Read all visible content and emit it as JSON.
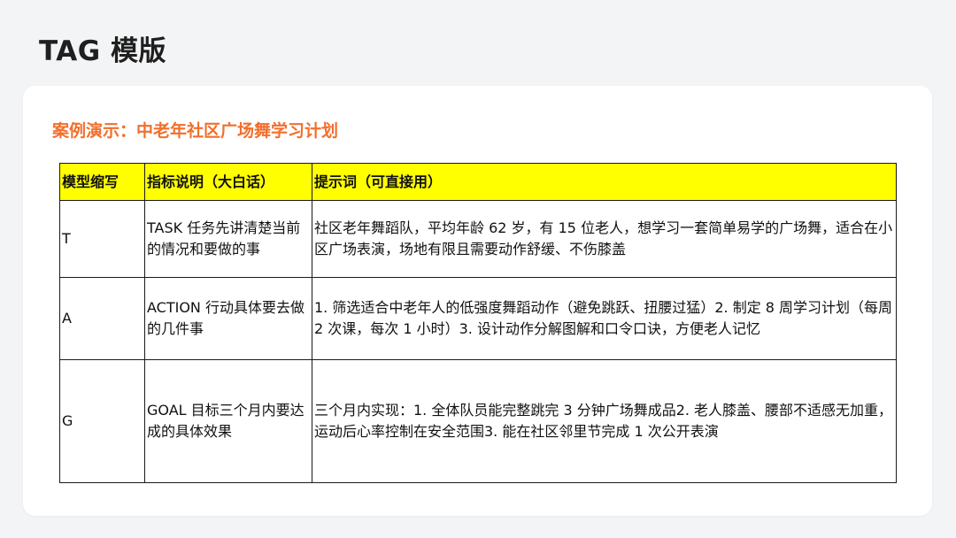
{
  "page": {
    "title": "TAG 模版"
  },
  "card": {
    "case_title": "案例演示：中老年社区广场舞学习计划"
  },
  "table": {
    "headers": [
      "模型缩写",
      "指标说明（大白话）",
      "提示词（可直接用）"
    ],
    "rows": [
      {
        "abbr": "T",
        "desc": "TASK 任务先讲清楚当前的情况和要做的事",
        "prompt": "社区老年舞蹈队，平均年龄 62 岁，有 15 位老人，想学习一套简单易学的广场舞，适合在小区广场表演，场地有限且需要动作舒缓、不伤膝盖"
      },
      {
        "abbr": "A",
        "desc": "ACTION 行动具体要去做的几件事",
        "prompt": "1. 筛选适合中老年人的低强度舞蹈动作（避免跳跃、扭腰过猛）2. 制定 8 周学习计划（每周 2 次课，每次 1 小时）3. 设计动作分解图解和口令口诀，方便老人记忆"
      },
      {
        "abbr": "G",
        "desc": "GOAL 目标三个月内要达成的具体效果",
        "prompt": "三个月内实现：1. 全体队员能完整跳完 3 分钟广场舞成品2. 老人膝盖、腰部不适感无加重，运动后心率控制在安全范围3. 能在社区邻里节完成 1 次公开表演"
      }
    ]
  },
  "colors": {
    "accent": "#f26f2c",
    "header_bg": "#ffff00",
    "page_bg": "#f3f4f6",
    "card_bg": "#ffffff"
  }
}
